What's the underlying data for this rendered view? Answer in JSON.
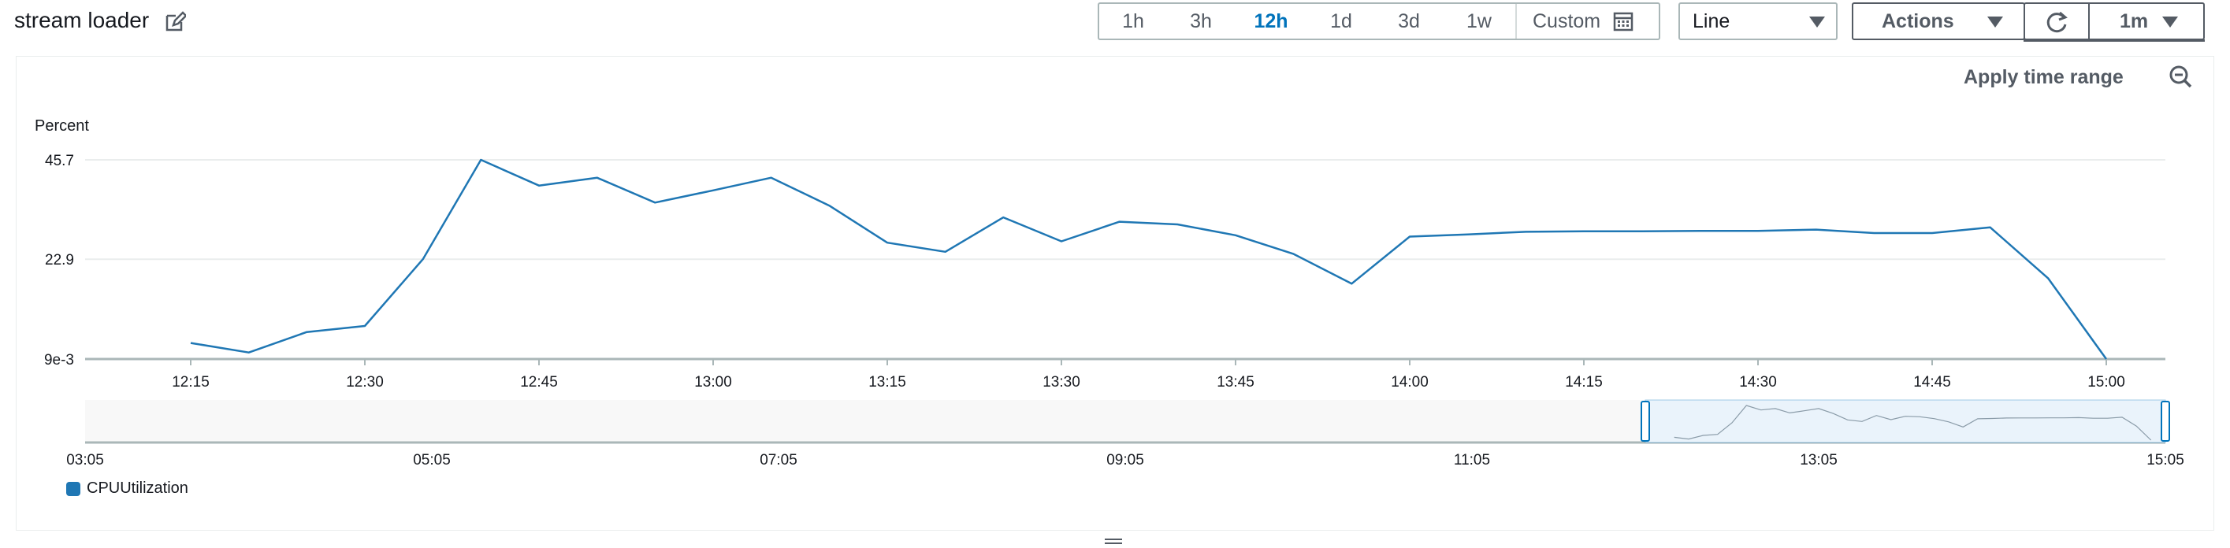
{
  "header": {
    "title": "stream loader",
    "time_ranges": [
      {
        "label": "1h",
        "active": false
      },
      {
        "label": "3h",
        "active": false
      },
      {
        "label": "12h",
        "active": true
      },
      {
        "label": "1d",
        "active": false
      },
      {
        "label": "3d",
        "active": false
      },
      {
        "label": "1w",
        "active": false
      }
    ],
    "custom_label": "Custom",
    "chart_type_select": "Line",
    "actions_label": "Actions",
    "interval_label": "1m",
    "accent_color": "#0073bb"
  },
  "panel": {
    "apply_time_range": "Apply time range"
  },
  "chart_data": {
    "type": "line",
    "ylabel": "Percent",
    "y_ticks": [
      "45.7",
      "22.9",
      "9e-3"
    ],
    "y_tick_values": [
      45.7,
      22.9,
      0.009
    ],
    "ylim": [
      0.009,
      45.7
    ],
    "x_ticks": [
      "12:15",
      "12:30",
      "12:45",
      "13:00",
      "13:15",
      "13:30",
      "13:45",
      "14:00",
      "14:15",
      "14:30",
      "14:45",
      "15:00"
    ],
    "x_range": [
      "12:15",
      "15:00"
    ],
    "grid": "horizontal",
    "line_color": "#1f77b4",
    "series": [
      {
        "name": "CPUUtilization",
        "x": [
          "12:15",
          "12:20",
          "12:25",
          "12:30",
          "12:35",
          "12:40",
          "12:45",
          "12:50",
          "12:55",
          "13:00",
          "13:05",
          "13:10",
          "13:15",
          "13:20",
          "13:25",
          "13:30",
          "13:35",
          "13:40",
          "13:45",
          "13:50",
          "13:55",
          "14:00",
          "14:05",
          "14:10",
          "14:15",
          "14:20",
          "14:25",
          "14:30",
          "14:35",
          "14:40",
          "14:45",
          "14:50",
          "14:55",
          "15:00"
        ],
        "values": [
          3.7,
          1.5,
          6.2,
          7.6,
          22.9,
          45.7,
          39.8,
          41.6,
          35.9,
          38.7,
          41.6,
          35.2,
          26.7,
          24.6,
          32.5,
          27.0,
          31.5,
          30.9,
          28.4,
          24.1,
          17.3,
          28.1,
          28.6,
          29.2,
          29.3,
          29.3,
          29.4,
          29.4,
          29.7,
          28.9,
          28.9,
          30.2,
          18.5,
          0.009
        ]
      }
    ],
    "navigator": {
      "x_ticks": [
        "03:05",
        "05:05",
        "07:05",
        "09:05",
        "11:05",
        "13:05",
        "15:05"
      ],
      "selected_range": [
        "12:05",
        "15:05"
      ]
    },
    "legend": [
      "CPUUtilization"
    ],
    "legend_placement": "bottom-left"
  }
}
